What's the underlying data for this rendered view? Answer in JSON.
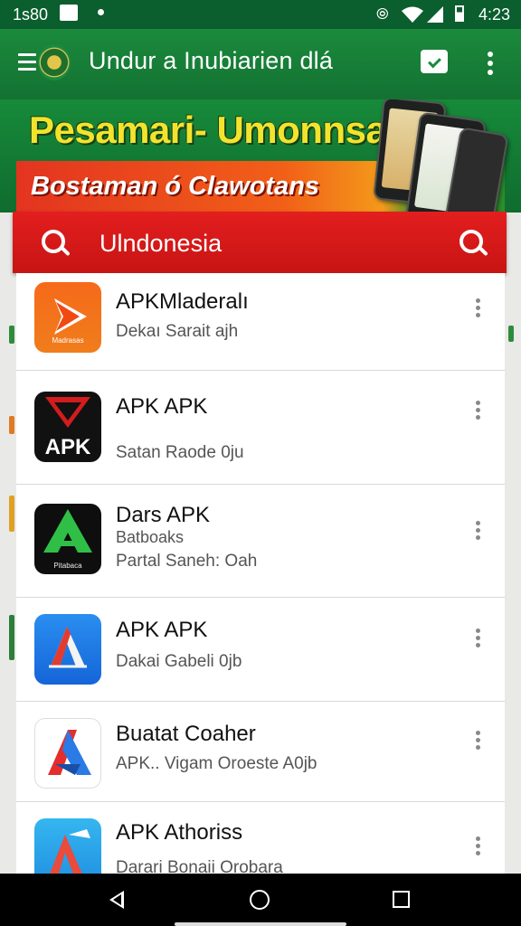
{
  "status_bar": {
    "time": "1s80",
    "clock": "4:23"
  },
  "app_bar": {
    "title": "Undur a Inubiarien dlá"
  },
  "banner": {
    "headline": "Pesamari- Umonnsan",
    "subline": "Bostaman ó Clawotans"
  },
  "search": {
    "query": "Ulndonesia"
  },
  "apps": [
    {
      "name": "APKMladeralı",
      "line1": "Dekaı Sarait ajh",
      "icon_label": "Madrasas"
    },
    {
      "name": "APK APK",
      "line1": "Satan Raode 0ju",
      "icon_label": "APK"
    },
    {
      "name": "Dars APK",
      "line1": "Batboaks",
      "line2": "Partal Saneh: Oah",
      "icon_label": "Pitabaca"
    },
    {
      "name": "APK APK",
      "line1": "Dakai Gabeli 0jb"
    },
    {
      "name": "Buatat Coaher",
      "line1": "APK.. Vigam Oroeste A0jb"
    },
    {
      "name": "APK Athoriss",
      "line1": "Darari Bonaii Orobara"
    }
  ],
  "colors": {
    "app_bar": "#1b8a3c",
    "search_bar": "#e31e1e",
    "banner_text": "#f2e42d"
  }
}
